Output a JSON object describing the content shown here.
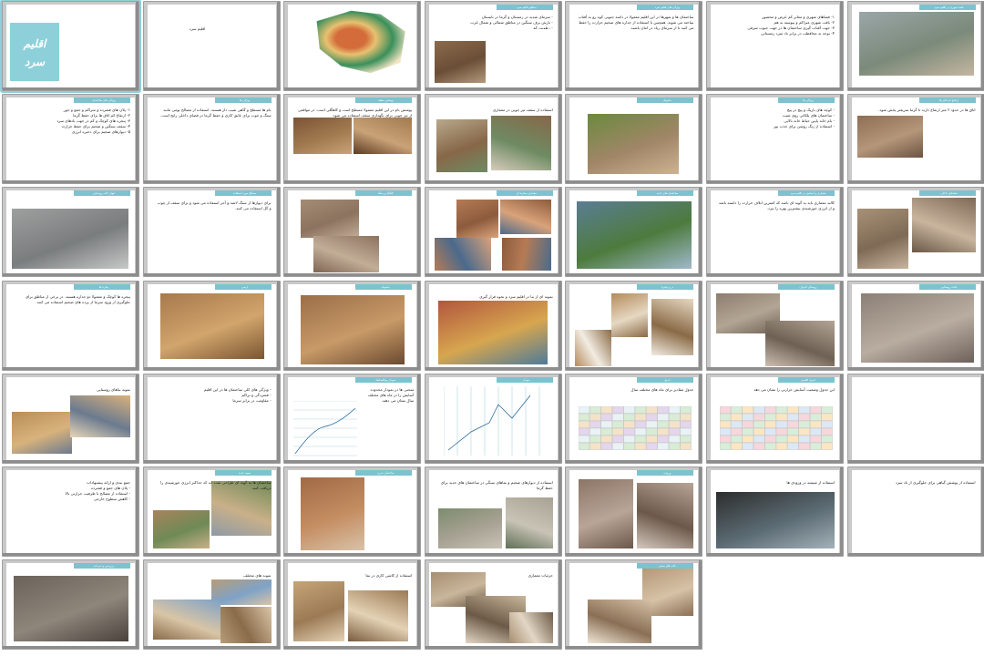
{
  "title_slide": {
    "word1": "اقلیم",
    "word2": "سرد"
  },
  "slides": [
    {
      "tab": "",
      "text": "",
      "photo": "title"
    },
    {
      "tab": "",
      "text": "اقلیم سرد",
      "photo": "none"
    },
    {
      "tab": "",
      "text": "",
      "photo": "map"
    },
    {
      "tab": "مناطق اقلیم سرد",
      "text": "- سرمای شدید در زمستان و گرما در تابستان\n- بارش برف سنگین در مناطق شمالی و شمال غرب\n- رطوبت کم\n- اختلاف زیاد حرارت بین شب و روز",
      "photo": "woodpile"
    },
    {
      "tab": "ویژگی های اقلیم سرد",
      "text": "ساختمان ها و شهرها در این اقلیم معمولا در دامنه جنوبی کوه رو به آفتاب ساخته می شوند. همچنین با استفاده از جداره های ضخیم حرارت را حفظ می کنند تا از سرمای زیاد در امان باشند.",
      "photo": "none"
    },
    {
      "tab": "",
      "text": "۱- فضاهای شهری و معابر کم عرض و محصور\n۲- بافت شهری متراکم و پیوسته به هم\n۳- جهت آفتاب گیری ساختمان ها در جهت جنوب شرقی\n۴- توجه به محافظت در برابر باد سرد زمستانی",
      "photo": "none"
    },
    {
      "tab": "بافت شهری در اقلیم سرد",
      "text": "",
      "photo": "city"
    },
    {
      "tab": "ویژگی های ساختمان",
      "text": "۱- پلان های فشرده و متراکم و جمع و جور\n۲- ارتفاع کم اتاق ها برای حفظ گرما\n۳- پنجره های کوچک و کم در جهت بادهای سرد\n۴- سقف سنگین و ضخیم برای حفظ حرارت\n۵- دیوارهای ضخیم برای ذخیره انرژی",
      "photo": "none"
    },
    {
      "tab": "ویژگی ها",
      "text": "بام ها مسطح و گاهی شیب دار هستند. استفاده از مصالح بومی مانند سنگ و چوب برای عایق کاری و حفظ گرما در فضای داخلی رایج است.",
      "photo": "none"
    },
    {
      "tab": "پوشش سقف",
      "text": "پوشش بام در این اقلیم معمولا مسطح است و کاهگلی است. در مواقعی از تیر چوبی برای نگهداری سقف استفاده می شود.",
      "photo": "ceiling"
    },
    {
      "tab": "",
      "text": "استفاده از سقف تیر چوبی در معماری",
      "photo": "timber"
    },
    {
      "tab": "ماسوله",
      "text": "",
      "photo": "masuleh"
    },
    {
      "tab": "ویژگی ها",
      "text": "- کوچه های باریک و پیچ در پیچ\n- ساختمان های پلکانی روی شیب\n- بام خانه پایین حیاط خانه بالایی\n- استفاده از رنگ روشن برای جذب نور",
      "photo": "none"
    },
    {
      "tab": "ارتفاع کم اتاق ها",
      "text": "اتاق ها در حدود ۲ متر ارتفاع دارند تا گرما سریعتر پخش شود.",
      "photo": "houses"
    },
    {
      "tab": "ایوان خانه روستایی",
      "text": "",
      "photo": "rural"
    },
    {
      "tab": "مصالح مورد استفاده",
      "text": "برای دیوارها از سنگ لاشه و آجر استفاده می شود و برای سقف از چوب و گل استفاده می کنند.",
      "photo": "none"
    },
    {
      "tab": "کاهگل و سنگ",
      "text": "",
      "photo": "texture"
    },
    {
      "tab": "معماری صخره ای",
      "text": "",
      "photo": "cave"
    },
    {
      "tab": "ساختمان های جدید",
      "text": "",
      "photo": "modern"
    },
    {
      "tab": "معماری و آسایش در اقلیم سرد",
      "text": "کالبد معماری باید به گونه ای باشد که کمترین اتلاف حرارت را داشته باشد و از انرژی خورشیدی بیشترین بهره را ببرد.",
      "photo": "none"
    },
    {
      "tab": "فضاهای داخلی",
      "text": "",
      "photo": "alley"
    },
    {
      "tab": "پنجره ها",
      "text": "پنجره ها کوچک و معمولا دو جداره هستند. در برخی از مناطق برای جلوگیری از ورود سرما از پرده های ضخیم استفاده می کنند.",
      "photo": "none"
    },
    {
      "tab": "ارسی",
      "text": "",
      "photo": "arcade"
    },
    {
      "tab": "ماسوله",
      "text": "",
      "photo": "balcony"
    },
    {
      "tab": "",
      "text": "نمونه ای از بنا در اقلیم سرد و نحوه قرار گیری",
      "photo": "colorful"
    },
    {
      "tab": "در و پنجره",
      "text": "",
      "photo": "doors"
    },
    {
      "tab": "روستای کندوان",
      "text": "",
      "photo": "kandovan"
    },
    {
      "tab": "بافت روستایی",
      "text": "",
      "photo": "village"
    },
    {
      "tab": "",
      "text": "نمونه بناهای روستایی",
      "photo": "adobe"
    },
    {
      "tab": "",
      "text": "- ویژگی های کلی ساختمان ها در این اقلیم\n- فشردگی و تراکم\n- مقاومت در برابر سرما",
      "photo": "none"
    },
    {
      "tab": "نمودار بیوکلیماتیک",
      "text": "منحنی ها در نمودار محدوده آسایش را در ماه های مختلف سال نشان می دهند.",
      "photo": "chart1"
    },
    {
      "tab": "نمودار",
      "text": "",
      "photo": "chart2"
    },
    {
      "tab": "جدول",
      "text": "جدول مقادیر برای ماه های مختلف سال",
      "photo": "table1"
    },
    {
      "tab": "جدول اقلیمی",
      "text": "این جدول وضعیت آسایش حرارتی را نشان می دهد",
      "photo": "table2"
    },
    {
      "tab": "",
      "text": "",
      "photo": "none"
    },
    {
      "tab": "",
      "text": "جمع بندی و ارائه پیشنهادات\n- پلان های جمع و فشرده\n- استفاده از مصالح با ظرفیت حرارتی بالا\n- کاهش سطوح خارجی",
      "photo": "none"
    },
    {
      "tab": "نمونه جدید",
      "text": "ساختمان ها به گونه ای طراحی شده اند که حداکثر انرژی خورشیدی را دریافت کنند.",
      "photo": "buildings"
    },
    {
      "tab": "ساختمان مدرن",
      "text": "",
      "photo": "tower"
    },
    {
      "tab": "",
      "text": "استفاده از دیوارهای ضخیم و نماهای سنگی در ساختمان های جدید برای حفظ گرما",
      "photo": "garden"
    },
    {
      "tab": "ورودی",
      "text": "",
      "photo": "doorway"
    },
    {
      "tab": "",
      "text": "استفاده از شیشه در ورودی ها",
      "photo": "glass"
    },
    {
      "tab": "",
      "text": "استفاده از پوشش گیاهی برای جلوگیری از باد سرد",
      "photo": "none"
    },
    {
      "tab": "زیرزمین و سرداب",
      "text": "",
      "photo": "cellar"
    },
    {
      "tab": "",
      "text": "نمونه های مختلف",
      "photo": "facades"
    },
    {
      "tab": "",
      "text": "استفاده از کاشی کاری در نما",
      "photo": "tiles"
    },
    {
      "tab": "",
      "text": "جزئیات معماری",
      "photo": "details"
    },
    {
      "tab": "خانه های سنتی",
      "text": "",
      "photo": "traditional"
    }
  ]
}
